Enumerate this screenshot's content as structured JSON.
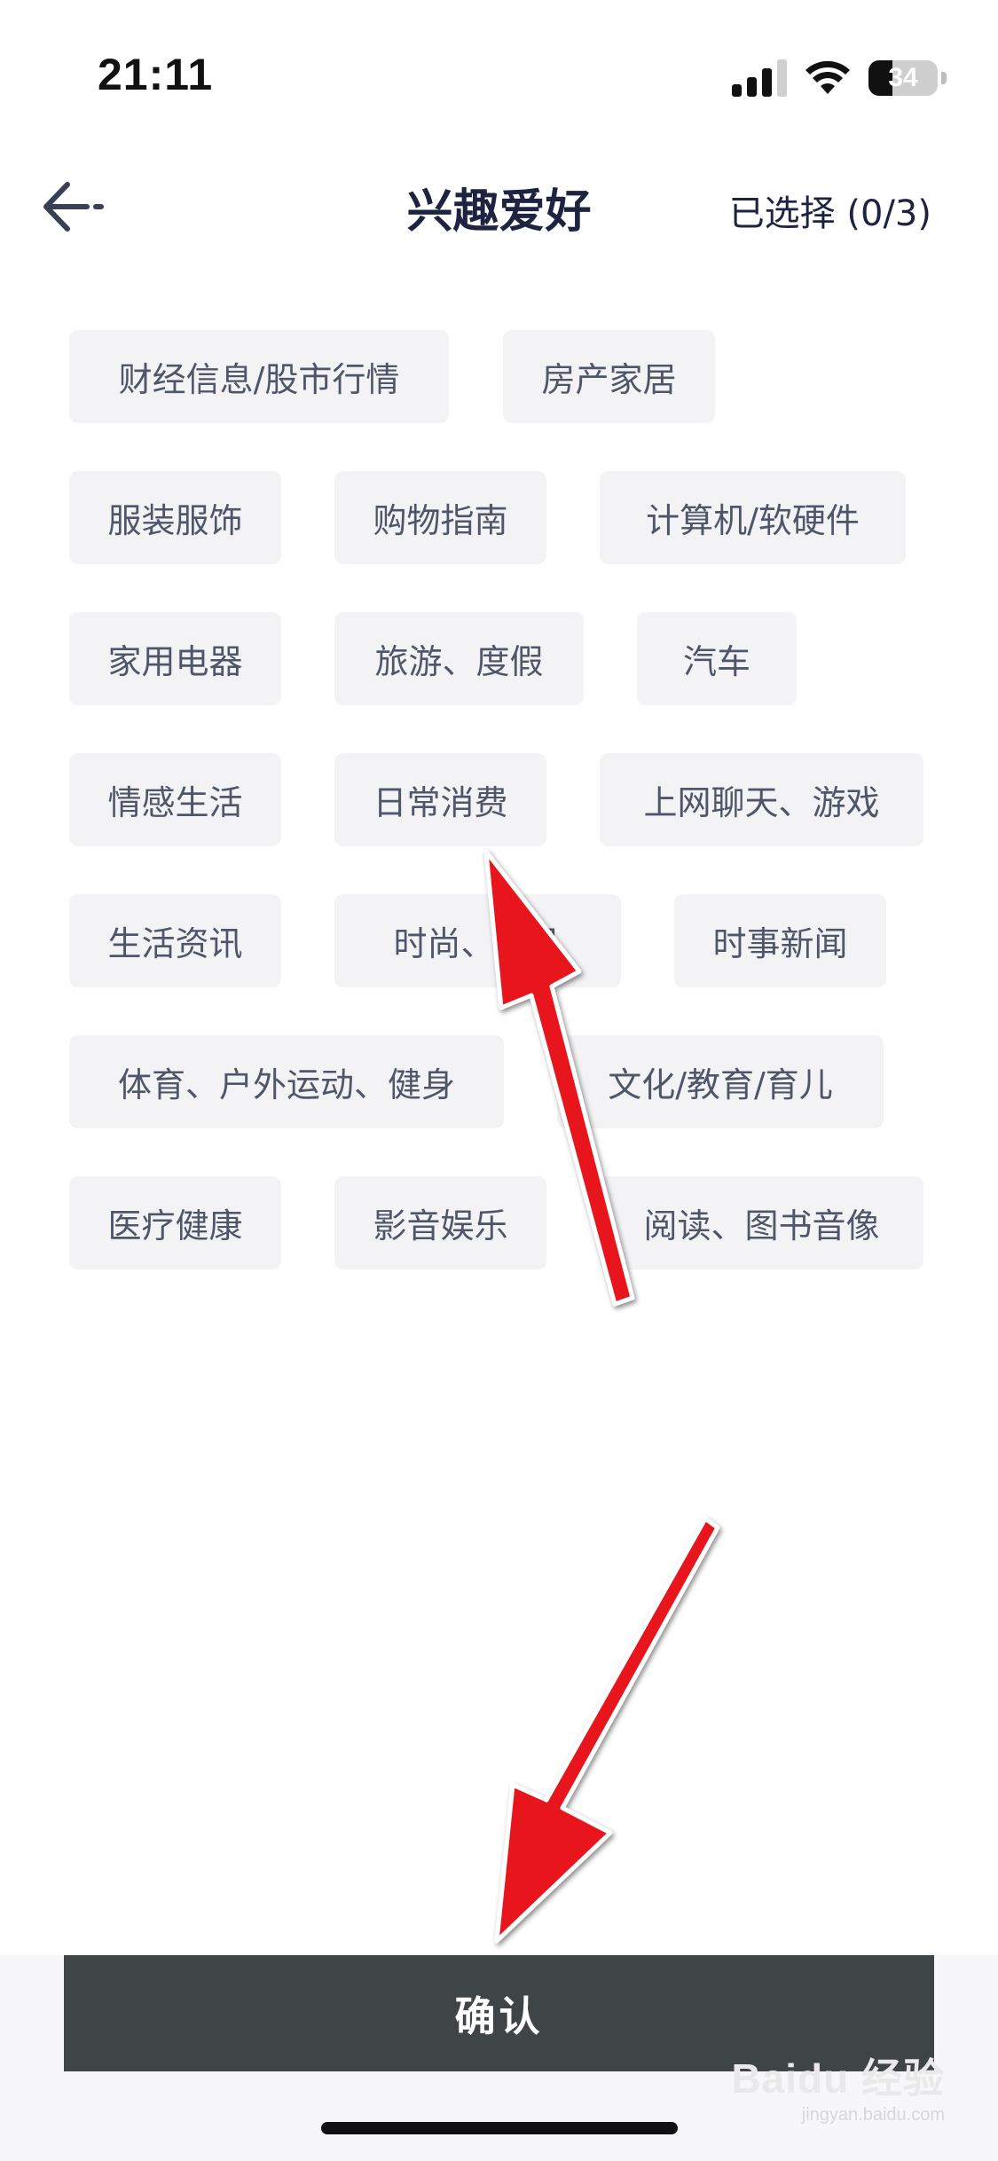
{
  "status_bar": {
    "time": "21:11",
    "battery": "34",
    "battery_level": 0.34
  },
  "header": {
    "title": "兴趣爱好",
    "selected_count": "已选择 (0/3)"
  },
  "tags": [
    "财经信息/股市行情",
    "房产家居",
    "服装服饰",
    "购物指南",
    "计算机/软硬件",
    "家用电器",
    "旅游、度假",
    "汽车",
    "情感生活",
    "日常消费",
    "上网聊天、游戏",
    "生活资讯",
    "时尚、饰品",
    "时事新闻",
    "体育、户外运动、健身",
    "文化/教育/育儿",
    "医疗健康",
    "影音娱乐",
    "阅读、图书音像"
  ],
  "confirm_label": "确认",
  "watermark": {
    "logo": "Baidu 经验",
    "sub": "jingyan.baidu.com"
  },
  "colors": {
    "title": "#1d2340",
    "tag_bg": "#f3f3f5",
    "tag_text": "#50566a",
    "confirm_bg": "#3f4446",
    "arrow": "#e8141b"
  }
}
